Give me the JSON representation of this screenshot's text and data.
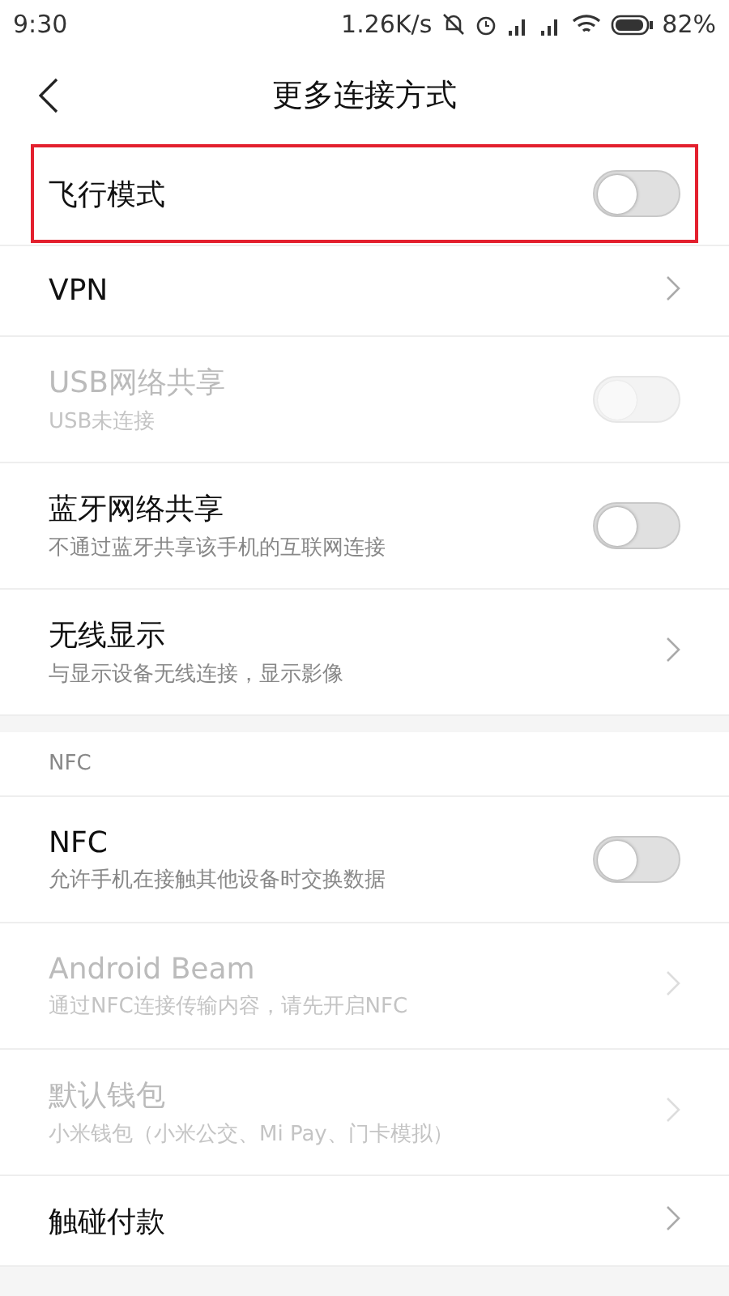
{
  "status_bar": {
    "time": "9:30",
    "speed": "1.26K/s",
    "battery": "82%"
  },
  "header": {
    "title": "更多连接方式"
  },
  "sections": [
    {
      "items": [
        {
          "kind": "toggle",
          "title": "飞行模式",
          "on": false,
          "disabled": false,
          "highlighted": true
        },
        {
          "kind": "link",
          "title": "VPN",
          "disabled": false
        },
        {
          "kind": "toggle",
          "title": "USB网络共享",
          "subtitle": "USB未连接",
          "on": false,
          "disabled": true
        },
        {
          "kind": "toggle",
          "title": "蓝牙网络共享",
          "subtitle": "不通过蓝牙共享该手机的互联网连接",
          "on": false,
          "disabled": false
        },
        {
          "kind": "link",
          "title": "无线显示",
          "subtitle": "与显示设备无线连接，显示影像",
          "disabled": false
        }
      ]
    },
    {
      "heading": "NFC",
      "items": [
        {
          "kind": "toggle",
          "title": "NFC",
          "subtitle": "允许手机在接触其他设备时交换数据",
          "on": false,
          "disabled": false
        },
        {
          "kind": "link",
          "title": "Android Beam",
          "subtitle": "通过NFC连接传输内容，请先开启NFC",
          "disabled": true
        },
        {
          "kind": "link",
          "title": "默认钱包",
          "subtitle": "小米钱包（小米公交、Mi Pay、门卡模拟）",
          "disabled": true
        },
        {
          "kind": "link",
          "title": "触碰付款",
          "disabled": false
        }
      ]
    }
  ]
}
